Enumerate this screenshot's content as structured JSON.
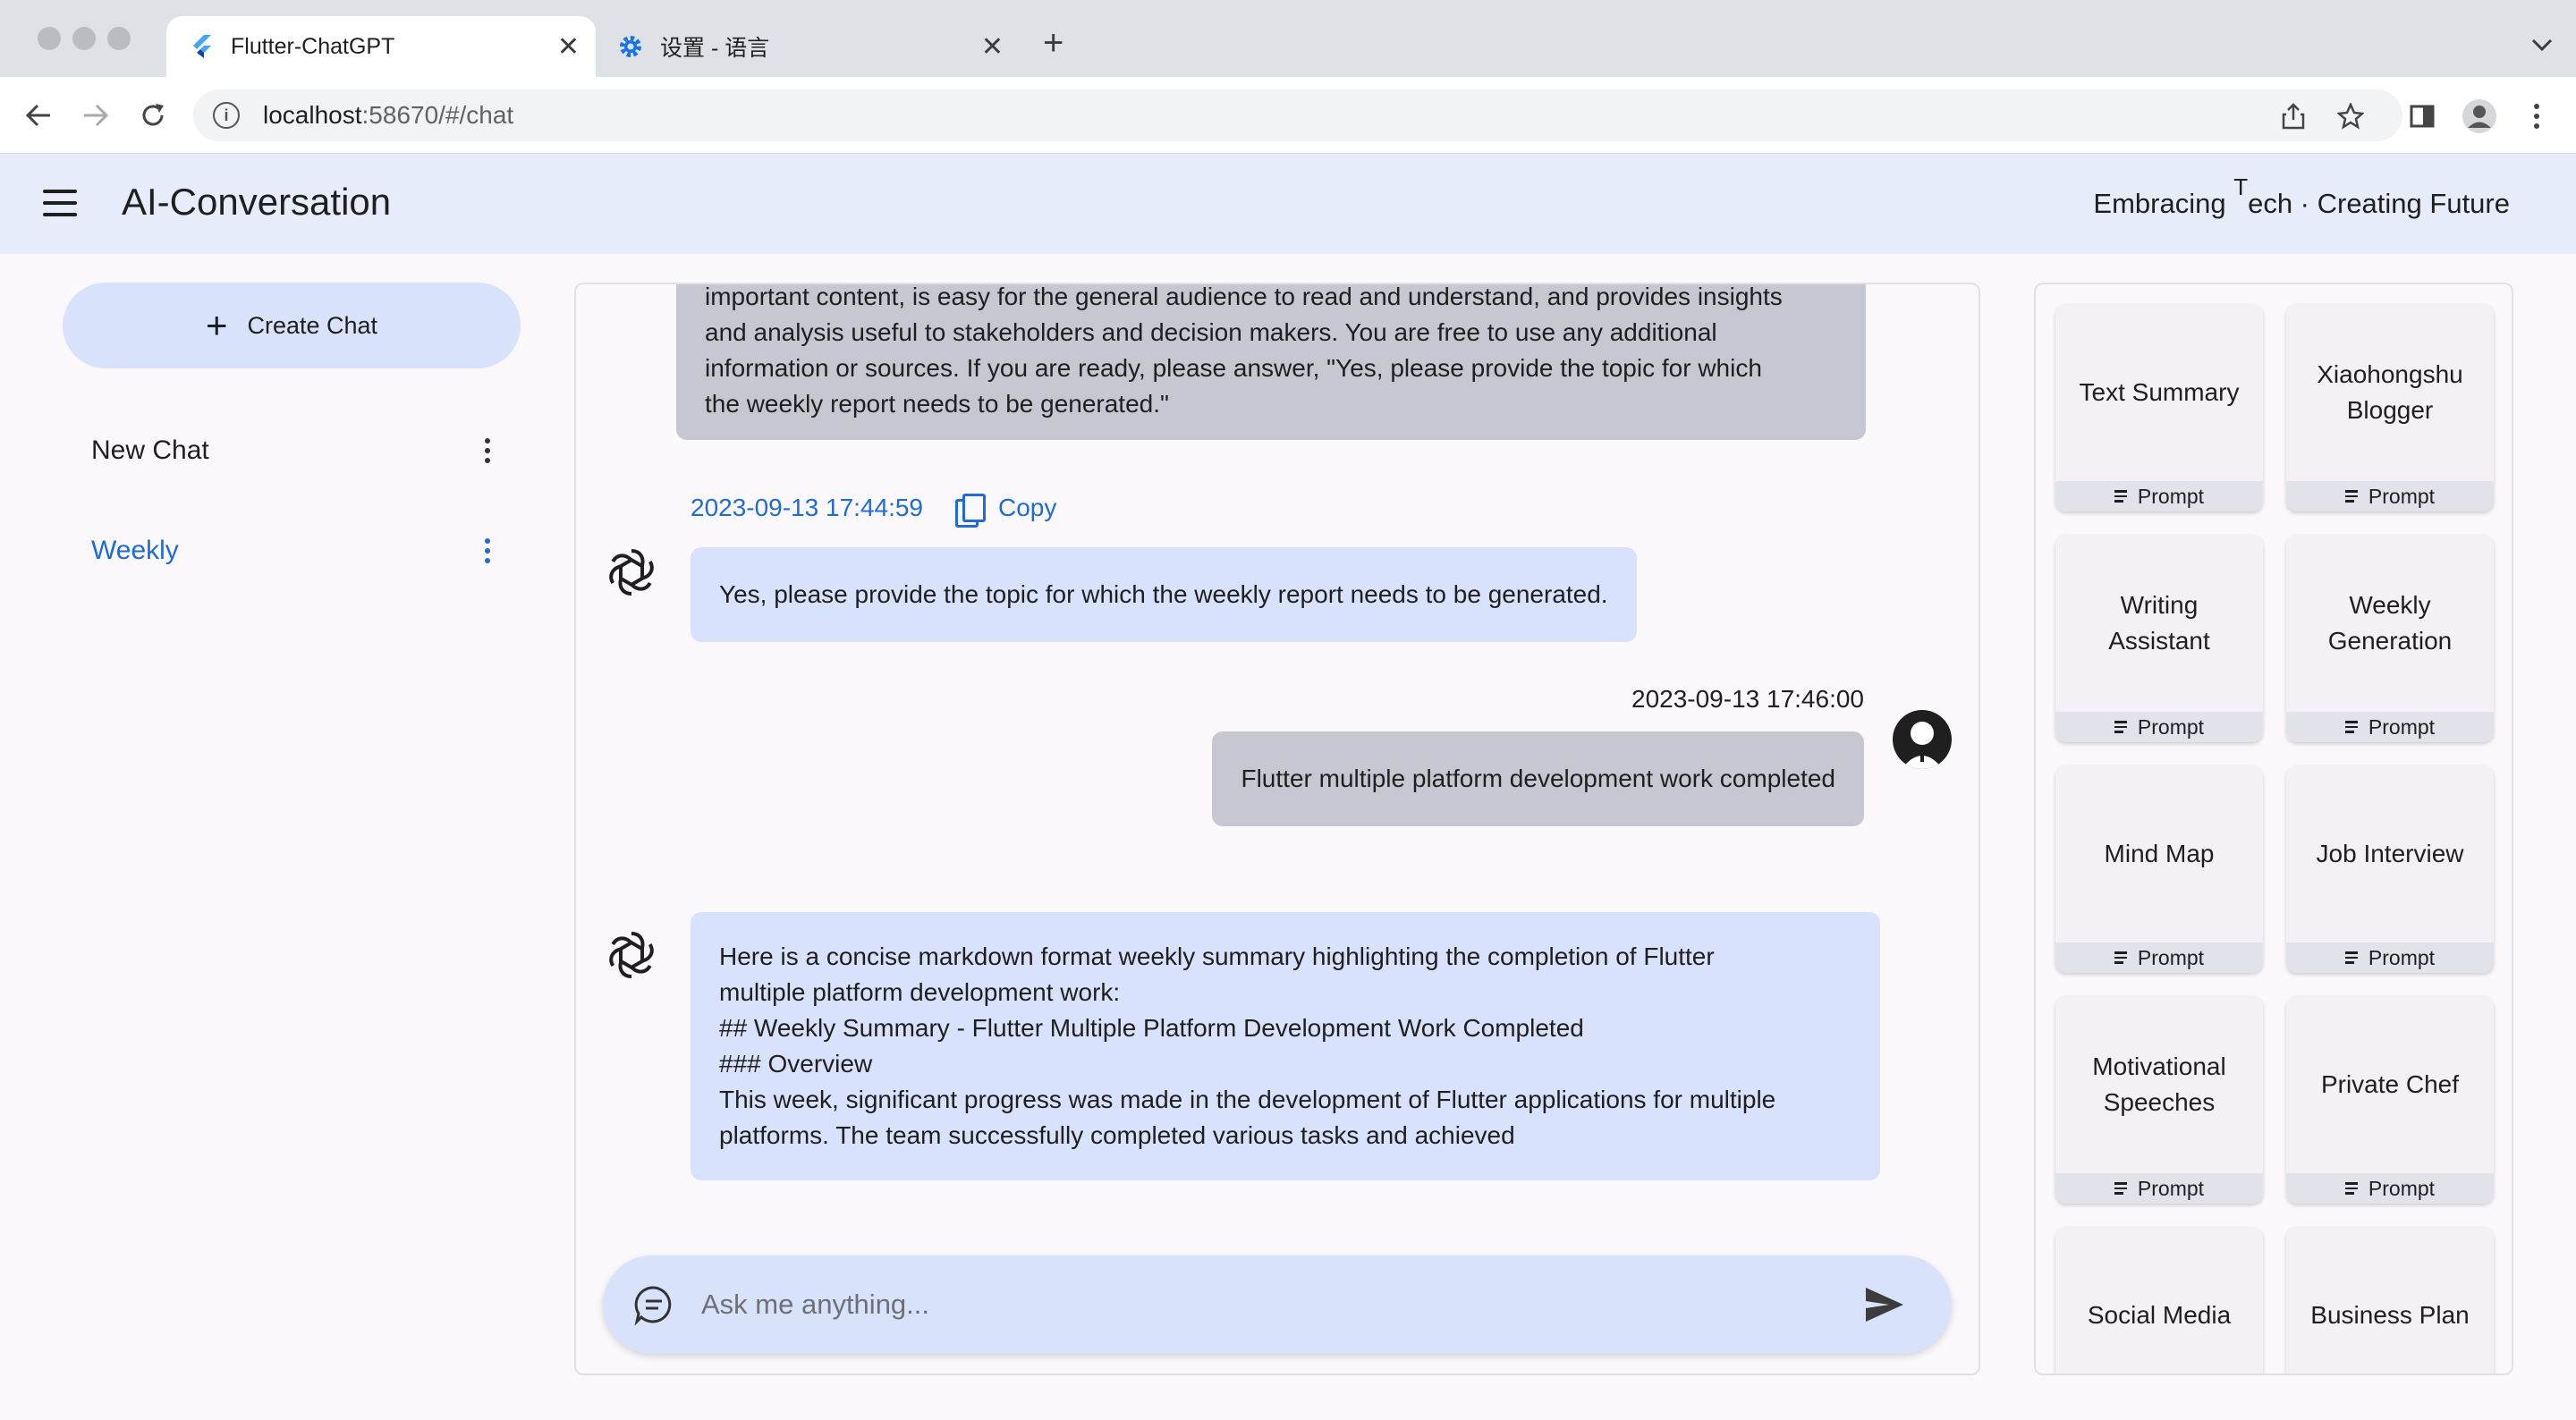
{
  "browser": {
    "tabs": [
      {
        "title": "Flutter-ChatGPT",
        "active": true
      },
      {
        "title": "设置 - 语言",
        "active": false
      }
    ],
    "url_host": "localhost",
    "url_rest": ":58670/#/chat"
  },
  "appbar": {
    "title": "AI-Conversation",
    "slogan_pre": "Embracing ",
    "slogan_T": "T",
    "slogan_post": "ech · Creating Future"
  },
  "sidebar": {
    "create_label": "Create Chat",
    "chats": [
      {
        "label": "New Chat",
        "selected": false
      },
      {
        "label": "Weekly",
        "selected": true
      }
    ]
  },
  "chat": {
    "messages": [
      {
        "role": "user",
        "lines": [
          "important content, is easy for the general audience to read and understand, and provides insights",
          "and analysis useful to stakeholders and decision makers. You are free to use any additional",
          "information or sources. If you are ready, please answer, \"Yes, please provide the topic for which",
          "the weekly report needs to be generated.\""
        ]
      },
      {
        "role": "assistant",
        "timestamp": "2023-09-13 17:44:59",
        "copy_label": "Copy",
        "lines": [
          "Yes, please provide the topic for which the weekly report needs to be generated."
        ]
      },
      {
        "role": "user",
        "timestamp": "2023-09-13 17:46:00",
        "lines": [
          "Flutter multiple platform development work completed"
        ]
      },
      {
        "role": "assistant",
        "lines": [
          "Here is a concise markdown format weekly summary highlighting the completion of Flutter",
          "multiple platform development work:",
          "## Weekly Summary - Flutter Multiple Platform Development Work Completed",
          "### Overview",
          "This week, significant progress was made in the development of Flutter applications for multiple",
          "platforms. The team successfully completed various tasks and achieved"
        ]
      }
    ],
    "input_placeholder": "Ask me anything..."
  },
  "prompts": {
    "footer_label": "Prompt",
    "cards": [
      [
        "Text Summary"
      ],
      [
        "Xiaohongshu",
        "Blogger"
      ],
      [
        "Writing",
        "Assistant"
      ],
      [
        "Weekly",
        "Generation"
      ],
      [
        "Mind Map"
      ],
      [
        "Job Interview"
      ],
      [
        "Motivational",
        "Speeches"
      ],
      [
        "Private Chef"
      ],
      [
        "Social Media"
      ],
      [
        "Business Plan"
      ]
    ]
  },
  "colors": {
    "accent": "#1e6bd6",
    "appbar_bg": "#e6ecf9",
    "ai_bubble": "#d9e2fd",
    "user_bubble": "#c6c7d0"
  }
}
